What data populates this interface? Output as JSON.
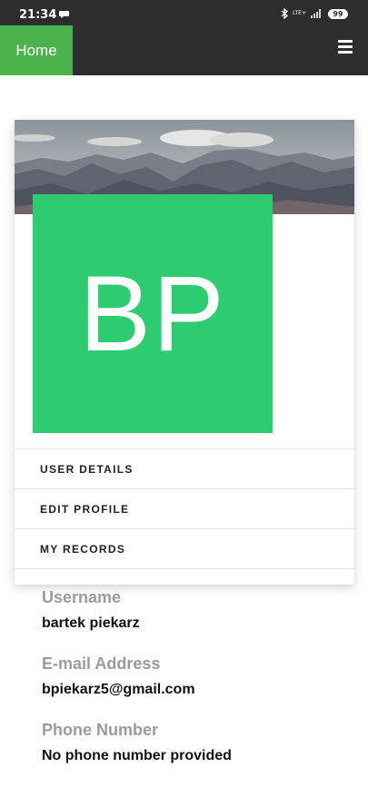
{
  "status_bar": {
    "time": "21:34",
    "network": "LTE+",
    "battery": "99"
  },
  "nav": {
    "home_label": "Home",
    "menu_icon": "hamburger-icon"
  },
  "profile": {
    "initials": "BP",
    "avatar_color": "#2ecc71",
    "menu_items": [
      "USER DETAILS",
      "EDIT PROFILE",
      "MY RECORDS"
    ]
  },
  "details": {
    "username_label": "Username",
    "username_value": "bartek piekarz",
    "email_label": "E-mail Address",
    "email_value": "bpiekarz5@gmail.com",
    "phone_label": "Phone Number",
    "phone_value": "No phone number provided"
  },
  "colors": {
    "status_bar": "#2d2d2d",
    "home_tab": "#4cb24c",
    "label_gray": "#9a9aa0"
  }
}
